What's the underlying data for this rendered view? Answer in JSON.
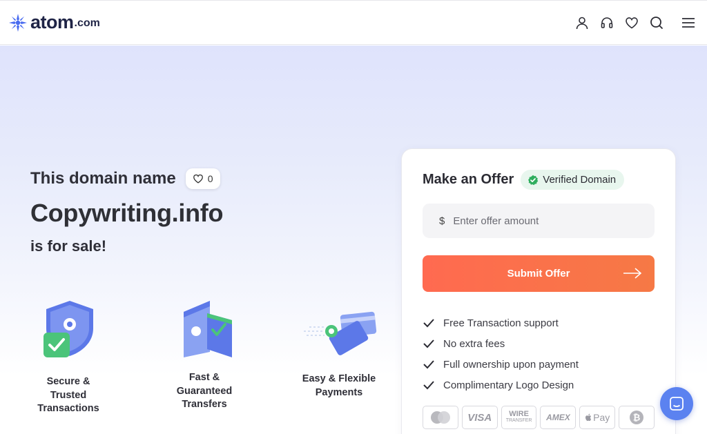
{
  "header": {
    "logo_text": "atom",
    "logo_tld": ".com",
    "icons": [
      "user-icon",
      "support-headset-icon",
      "heart-icon",
      "search-icon",
      "menu-icon"
    ]
  },
  "hero": {
    "line1": "This domain name",
    "like_count": "0",
    "domain": "Copywriting.info",
    "line3": "is for sale!"
  },
  "features": [
    {
      "line1": "Secure &",
      "line2": "Trusted",
      "line3": "Transactions"
    },
    {
      "line1": "Fast &",
      "line2": "Guaranteed",
      "line3": "Transfers"
    },
    {
      "line1": "Easy & Flexible",
      "line2": "Payments"
    }
  ],
  "offer": {
    "title": "Make an Offer",
    "verified": "Verified Domain",
    "currency": "$",
    "placeholder": "Enter offer amount",
    "submit": "Submit Offer",
    "benefits": [
      "Free Transaction support",
      "No extra fees",
      "Full ownership upon payment",
      "Complimentary Logo Design"
    ],
    "payments": [
      "mastercard",
      "VISA",
      "WIRE TRANSFER",
      "AMEX",
      "Pay",
      "bitcoin"
    ],
    "payment_labels": {
      "visa": "VISA",
      "wire1": "WIRE",
      "wire2": "TRANSFER",
      "amex": "AMEX",
      "applepay": "Pay"
    }
  },
  "colors": {
    "accent": "#ff6a50",
    "brand": "#1f2446",
    "logo_blue": "#4a6cf0",
    "verified_bg": "#e8f6ee",
    "verified_green": "#2fae5e",
    "chat": "#5b82f0"
  }
}
